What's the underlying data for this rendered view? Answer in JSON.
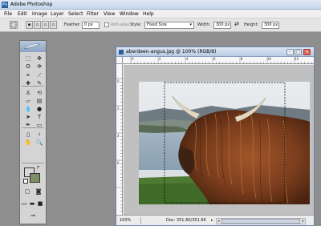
{
  "app": {
    "title": "Adobe Photoshop",
    "icon": "ps-app-icon"
  },
  "menu": {
    "items": [
      {
        "label": "File"
      },
      {
        "label": "Edit"
      },
      {
        "label": "Image"
      },
      {
        "label": "Layer"
      },
      {
        "label": "Select"
      },
      {
        "label": "Filter"
      },
      {
        "label": "View"
      },
      {
        "label": "Window"
      },
      {
        "label": "Help"
      }
    ]
  },
  "options_bar": {
    "feather_label": "Feather:",
    "feather_value": "0 px",
    "antialias_label": "Anti-alias",
    "style_label": "Style:",
    "style_value": "Fixed Size",
    "width_label": "Width:",
    "width_value": "300 px",
    "swap_symbol": "⇄",
    "height_label": "Height:",
    "height_value": "300 px"
  },
  "toolbox": {
    "tools": [
      {
        "name": "rectangular-marquee-tool",
        "glyph": "⬚"
      },
      {
        "name": "move-tool",
        "glyph": "✥"
      },
      {
        "name": "lasso-tool",
        "glyph": "ʘ"
      },
      {
        "name": "magic-wand-tool",
        "glyph": "✲"
      },
      {
        "name": "crop-tool",
        "glyph": "⌗"
      },
      {
        "name": "slice-tool",
        "glyph": "⟋"
      },
      {
        "name": "healing-brush-tool",
        "glyph": "✚"
      },
      {
        "name": "brush-tool",
        "glyph": "✎"
      },
      {
        "name": "clone-stamp-tool",
        "glyph": "♙"
      },
      {
        "name": "history-brush-tool",
        "glyph": "⟲"
      },
      {
        "name": "eraser-tool",
        "glyph": "▱"
      },
      {
        "name": "gradient-tool",
        "glyph": "▤"
      },
      {
        "name": "blur-tool",
        "glyph": "💧"
      },
      {
        "name": "dodge-tool",
        "glyph": "●"
      },
      {
        "name": "path-selection-tool",
        "glyph": "➤"
      },
      {
        "name": "type-tool",
        "glyph": "T"
      },
      {
        "name": "pen-tool",
        "glyph": "✒"
      },
      {
        "name": "shape-tool",
        "glyph": "▭"
      },
      {
        "name": "notes-tool",
        "glyph": "▯"
      },
      {
        "name": "eyedropper-tool",
        "glyph": "⟊"
      },
      {
        "name": "hand-tool",
        "glyph": "✋"
      },
      {
        "name": "zoom-tool",
        "glyph": "🔍"
      }
    ],
    "foreground_color": "#d9d9d9",
    "background_color": "#7a8f62"
  },
  "document": {
    "title": "aberdeen-angus.jpg @ 100% (RGB/8)",
    "ruler_top": [
      "0",
      "2",
      "4",
      "6",
      "8",
      "10",
      "12"
    ],
    "ruler_left": [
      "0",
      "2",
      "4",
      "6"
    ],
    "zoom": "100%",
    "doc_info": "Doc: 351.6K/351.6K"
  },
  "colors": {
    "workspace": "#8e8e8e",
    "title_gradient_top": "#dfe9f6",
    "toolbox_bg": "#d4d4d4"
  }
}
